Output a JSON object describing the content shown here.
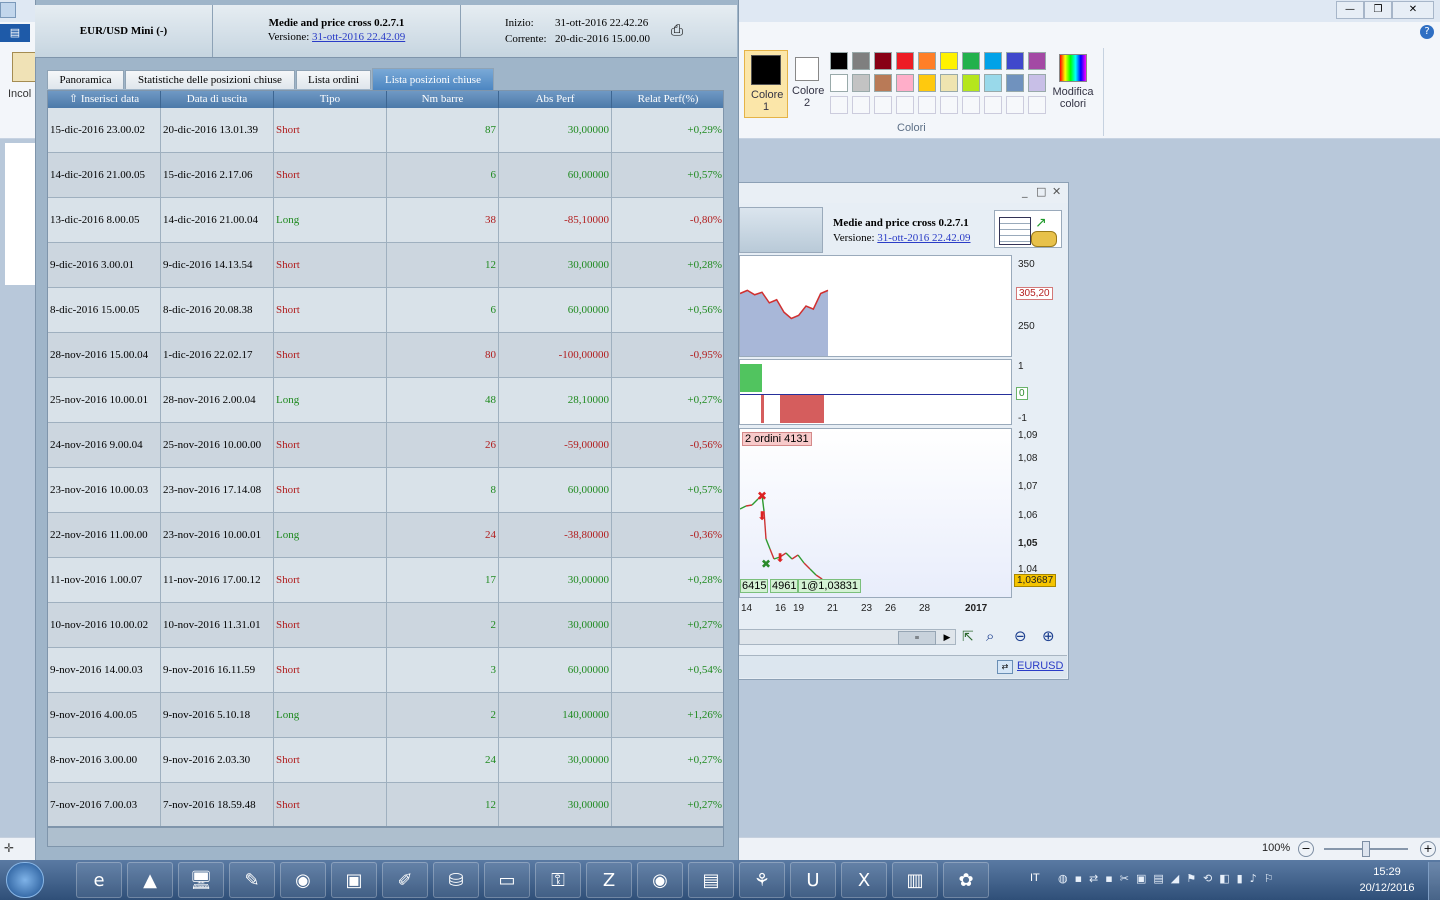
{
  "paint": {
    "ribbon_partial_label": "Incol",
    "colore1_label": "Colore 1",
    "colore2_label": "Colore 2",
    "colori_group_label": "Colori",
    "modifica_colori_label": "Modifica colori",
    "palette_row1": [
      "#000000",
      "#7f7f7f",
      "#880015",
      "#ed1c24",
      "#ff7f27",
      "#fff200",
      "#22b14c",
      "#00a2e8",
      "#3f48cc",
      "#a349a4"
    ],
    "palette_row2": [
      "#ffffff",
      "#c3c3c3",
      "#b97a57",
      "#ffaec9",
      "#ffc90e",
      "#efe4b0",
      "#b5e61d",
      "#99d9ea",
      "#7092be",
      "#c8bfe7"
    ],
    "zoom_level": "100%",
    "help_icon": "question-icon"
  },
  "dialog": {
    "instrument": "EUR/USD Mini (-)",
    "strategy_name": "Medie and price cross 0.2.7.1",
    "version_label": "Versione:",
    "version_value": "31-ott-2016 22.42.09",
    "inizio_label": "Inizio:",
    "inizio_value": "31-ott-2016 22.42.26",
    "corrente_label": "Corrente:",
    "corrente_value": "20-dic-2016 15.00.00",
    "tabs": [
      "Panoramica",
      "Statistiche delle posizioni chiuse",
      "Lista ordini",
      "Lista posizioni chiuse"
    ],
    "active_tab": "Lista posizioni chiuse",
    "columns": [
      "Inserisci data",
      "Data di uscita",
      "Tipo",
      "Nm barre",
      "Abs Perf",
      "Relat Perf(%)"
    ],
    "sort_indicator": "⇧",
    "rows": [
      {
        "entry": "15-dic-2016 23.00.02",
        "exit": "20-dic-2016 13.01.39",
        "type": "Short",
        "bars": "87",
        "abs": "30,00000",
        "rel": "+0,29%"
      },
      {
        "entry": "14-dic-2016 21.00.05",
        "exit": "15-dic-2016 2.17.06",
        "type": "Short",
        "bars": "6",
        "abs": "60,00000",
        "rel": "+0,57%"
      },
      {
        "entry": "13-dic-2016 8.00.05",
        "exit": "14-dic-2016 21.00.04",
        "type": "Long",
        "bars": "38",
        "abs": "-85,10000",
        "rel": "-0,80%"
      },
      {
        "entry": "9-dic-2016 3.00.01",
        "exit": "9-dic-2016 14.13.54",
        "type": "Short",
        "bars": "12",
        "abs": "30,00000",
        "rel": "+0,28%"
      },
      {
        "entry": "8-dic-2016 15.00.05",
        "exit": "8-dic-2016 20.08.38",
        "type": "Short",
        "bars": "6",
        "abs": "60,00000",
        "rel": "+0,56%"
      },
      {
        "entry": "28-nov-2016 15.00.04",
        "exit": "1-dic-2016 22.02.17",
        "type": "Short",
        "bars": "80",
        "abs": "-100,00000",
        "rel": "-0,95%"
      },
      {
        "entry": "25-nov-2016 10.00.01",
        "exit": "28-nov-2016 2.00.04",
        "type": "Long",
        "bars": "48",
        "abs": "28,10000",
        "rel": "+0,27%"
      },
      {
        "entry": "24-nov-2016 9.00.04",
        "exit": "25-nov-2016 10.00.00",
        "type": "Short",
        "bars": "26",
        "abs": "-59,00000",
        "rel": "-0,56%"
      },
      {
        "entry": "23-nov-2016 10.00.03",
        "exit": "23-nov-2016 17.14.08",
        "type": "Short",
        "bars": "8",
        "abs": "60,00000",
        "rel": "+0,57%"
      },
      {
        "entry": "22-nov-2016 11.00.00",
        "exit": "23-nov-2016 10.00.01",
        "type": "Long",
        "bars": "24",
        "abs": "-38,80000",
        "rel": "-0,36%"
      },
      {
        "entry": "11-nov-2016 1.00.07",
        "exit": "11-nov-2016 17.00.12",
        "type": "Short",
        "bars": "17",
        "abs": "30,00000",
        "rel": "+0,28%"
      },
      {
        "entry": "10-nov-2016 10.00.02",
        "exit": "10-nov-2016 11.31.01",
        "type": "Short",
        "bars": "2",
        "abs": "30,00000",
        "rel": "+0,27%"
      },
      {
        "entry": "9-nov-2016 14.00.03",
        "exit": "9-nov-2016 16.11.59",
        "type": "Short",
        "bars": "3",
        "abs": "60,00000",
        "rel": "+0,54%"
      },
      {
        "entry": "9-nov-2016 4.00.05",
        "exit": "9-nov-2016 5.10.18",
        "type": "Long",
        "bars": "2",
        "abs": "140,00000",
        "rel": "+1,26%"
      },
      {
        "entry": "8-nov-2016 3.00.00",
        "exit": "9-nov-2016 2.03.30",
        "type": "Short",
        "bars": "24",
        "abs": "30,00000",
        "rel": "+0,27%"
      },
      {
        "entry": "7-nov-2016 7.00.03",
        "exit": "7-nov-2016 18.59.48",
        "type": "Short",
        "bars": "12",
        "abs": "30,00000",
        "rel": "+0,27%"
      }
    ]
  },
  "chart_window": {
    "strategy_name": "Medie and price cross 0.2.7.1",
    "version_label": "Versione:",
    "version_value": "31-ott-2016 22.42.09",
    "equity_axis": [
      "350",
      "250"
    ],
    "equity_current": "305,20",
    "signal_axis": [
      "1",
      "-1"
    ],
    "signal_current": "0",
    "price_axis": [
      "1,09",
      "1,08",
      "1,07",
      "1,06",
      "1,05",
      "1,04"
    ],
    "price_current": "1,03687",
    "orders_label": "2 ordini",
    "orders_partial": "4131",
    "bottom_labels": [
      "6415",
      "4961",
      "1@1,03831"
    ],
    "x_ticks": [
      "14",
      "16",
      "19",
      "21",
      "23",
      "26",
      "28",
      "2017"
    ],
    "symbol_link": "EURUSD",
    "chart_data": {
      "type": "line",
      "title": "",
      "xlabel": "",
      "ylabel": "",
      "series": [
        {
          "values": [
            300,
            305,
            298,
            302,
            285,
            290,
            270,
            260,
            265,
            280,
            275,
            300,
            305
          ]
        }
      ],
      "ylim": [
        200,
        360
      ]
    }
  },
  "taskbar": {
    "language": "IT",
    "time": "15:29",
    "date": "20/12/2016",
    "icons": [
      "start-orb",
      "internet-explorer-icon",
      "vlc-icon",
      "remote-desktop-icon",
      "ultraedit-tools-icon",
      "chrome-icon",
      "terminal-screen-icon",
      "notepad-plus-icon",
      "database-icon",
      "command-prompt-icon",
      "security-icon",
      "filezilla-icon",
      "chrome-icon",
      "folder-icon",
      "network-icon",
      "ue-icon",
      "excel-icon",
      "chart-app-icon",
      "paint-icon"
    ]
  }
}
